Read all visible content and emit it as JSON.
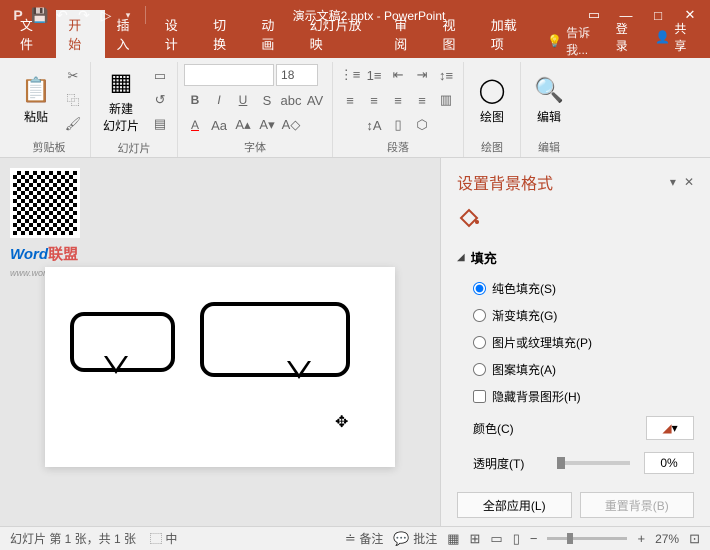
{
  "title": "演示文稿2.pptx - PowerPoint",
  "qat": {
    "save": "💾",
    "undo": "↶",
    "redo": "↷",
    "start": "▷"
  },
  "tabs": {
    "file": "文件",
    "home": "开始",
    "insert": "插入",
    "design": "设计",
    "transitions": "切换",
    "animations": "动画",
    "slideshow": "幻灯片放映",
    "review": "审阅",
    "view": "视图",
    "addins": "加载项"
  },
  "tellme": "告诉我...",
  "login": "登录",
  "share": "共享",
  "ribbon": {
    "paste": "粘贴",
    "clipboard": "剪贴板",
    "newslide": "新建\n幻灯片",
    "slides": "幻灯片",
    "fontname": "",
    "fontsize": "18",
    "font": "字体",
    "paragraph": "段落",
    "drawing": "绘图",
    "drawing_btn": "绘图",
    "editing": "编辑",
    "editing_btn": "编辑"
  },
  "watermark": {
    "word": "Word",
    "lianmeng": "联盟",
    "url": "www.wordlm.com"
  },
  "panel": {
    "title": "设置背景格式",
    "fill": "填充",
    "solid": "纯色填充(S)",
    "gradient": "渐变填充(G)",
    "picture": "图片或纹理填充(P)",
    "pattern": "图案填充(A)",
    "hide": "隐藏背景图形(H)",
    "color": "颜色(C)",
    "transparency": "透明度(T)",
    "transparency_val": "0%",
    "applyall": "全部应用(L)",
    "reset": "重置背景(B)"
  },
  "status": {
    "slideinfo": "幻灯片 第 1 张，共 1 张",
    "lang": "中",
    "notes": "备注",
    "comments": "批注",
    "zoom": "27%"
  }
}
